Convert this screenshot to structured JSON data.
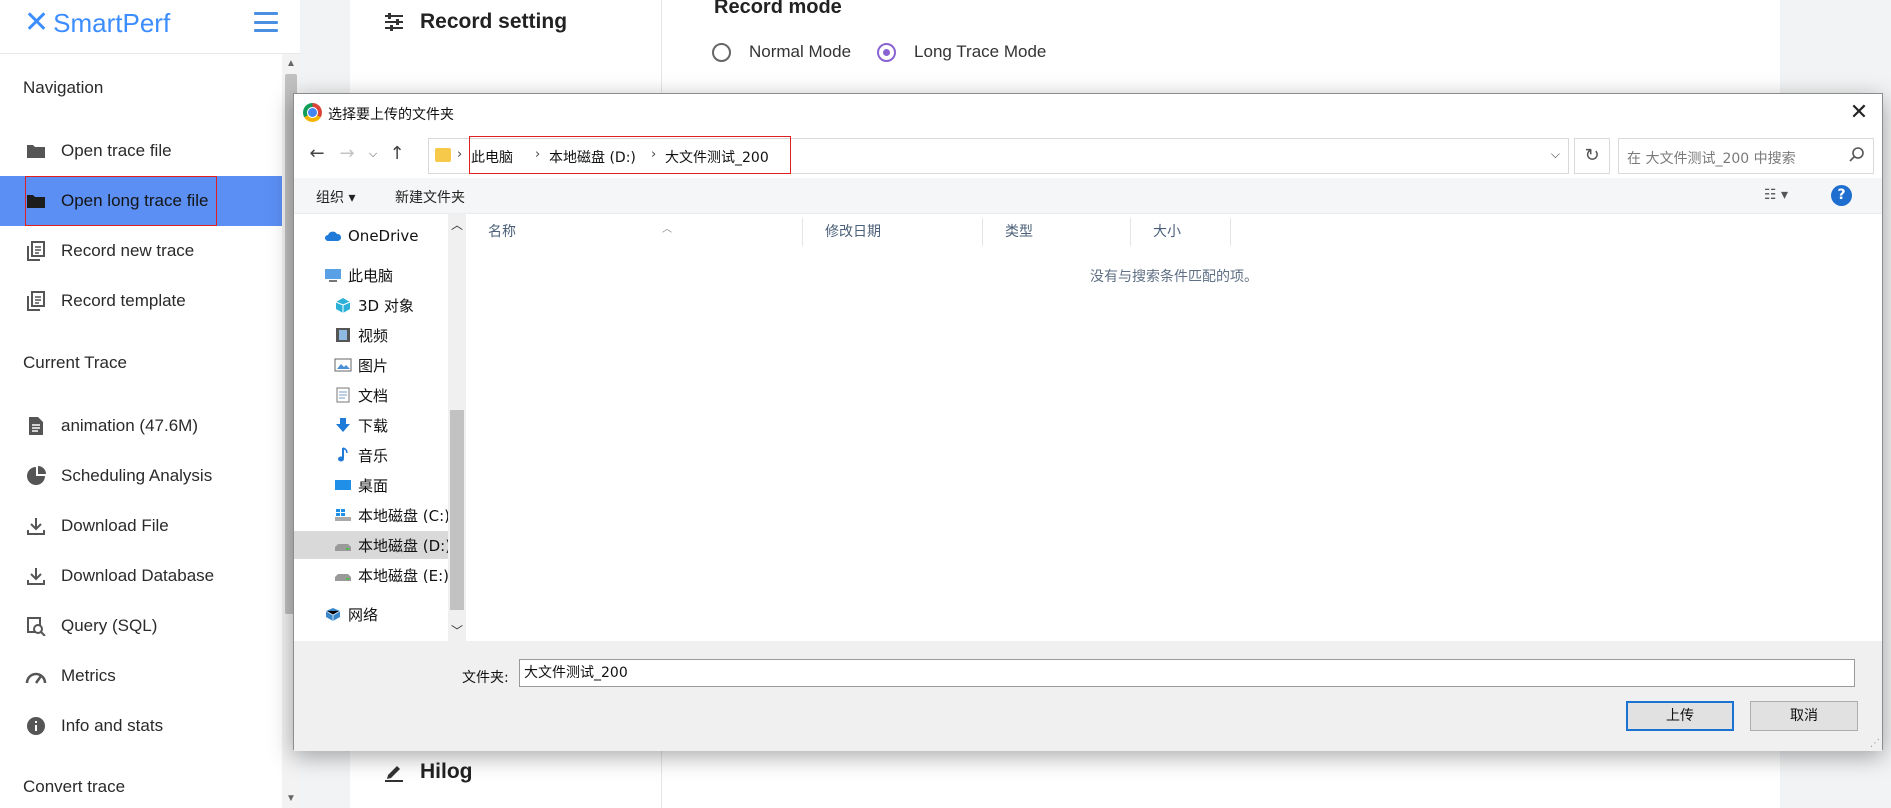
{
  "app": {
    "brand": "SmartPerf",
    "nav": {
      "navigation_heading": "Navigation",
      "navigation_items": [
        {
          "label": "Open trace file",
          "icon": "folder-icon"
        },
        {
          "label": "Open long trace file",
          "icon": "folder-icon",
          "active": true
        },
        {
          "label": "Record new trace",
          "icon": "copy-icon"
        },
        {
          "label": "Record template",
          "icon": "copy-icon"
        }
      ],
      "current_heading": "Current Trace",
      "current_items": [
        {
          "label": "animation (47.6M)",
          "icon": "file-icon"
        },
        {
          "label": "Scheduling Analysis",
          "icon": "pie-chart-icon"
        },
        {
          "label": "Download File",
          "icon": "download-icon"
        },
        {
          "label": "Download Database",
          "icon": "download-icon"
        },
        {
          "label": "Query (SQL)",
          "icon": "query-icon"
        },
        {
          "label": "Metrics",
          "icon": "gauge-icon"
        },
        {
          "label": "Info and stats",
          "icon": "info-icon"
        }
      ],
      "convert_heading": "Convert trace"
    },
    "content": {
      "record_setting": "Record setting",
      "hilog": "Hilog",
      "record_mode_title": "Record mode",
      "mode_options": [
        "Normal Mode",
        "Long Trace Mode"
      ],
      "selected_mode": "Long Trace Mode"
    },
    "colors": {
      "accent": "#3c8dff",
      "active_item": "#5b8ff3",
      "radio": "#8a63d2",
      "highlight": "#e02020"
    }
  },
  "dialog": {
    "title": "选择要上传的文件夹",
    "breadcrumb": [
      "此电脑",
      "本地磁盘 (D:)",
      "大文件测试_200"
    ],
    "search_placeholder": "在 大文件测试_200 中搜索",
    "toolbar": {
      "organize": "组织 ▾",
      "new_folder": "新建文件夹"
    },
    "tree": [
      {
        "label": "OneDrive",
        "icon": "cloud-icon"
      },
      {
        "label": "此电脑",
        "icon": "computer-icon"
      },
      {
        "label": "3D 对象",
        "icon": "cube-icon"
      },
      {
        "label": "视频",
        "icon": "video-icon"
      },
      {
        "label": "图片",
        "icon": "picture-icon"
      },
      {
        "label": "文档",
        "icon": "document-icon"
      },
      {
        "label": "下载",
        "icon": "download-arrow-icon"
      },
      {
        "label": "音乐",
        "icon": "music-icon"
      },
      {
        "label": "桌面",
        "icon": "desktop-icon"
      },
      {
        "label": "本地磁盘 (C:)",
        "icon": "windows-drive-icon"
      },
      {
        "label": "本地磁盘 (D:)",
        "icon": "drive-icon",
        "selected": true
      },
      {
        "label": "本地磁盘 (E:)",
        "icon": "drive-icon"
      },
      {
        "label": "网络",
        "icon": "network-icon"
      }
    ],
    "columns": [
      "名称",
      "修改日期",
      "类型",
      "大小"
    ],
    "empty_message": "没有与搜索条件匹配的项。",
    "folder_label": "文件夹:",
    "folder_value": "大文件测试_200",
    "upload_button": "上传",
    "cancel_button": "取消"
  }
}
